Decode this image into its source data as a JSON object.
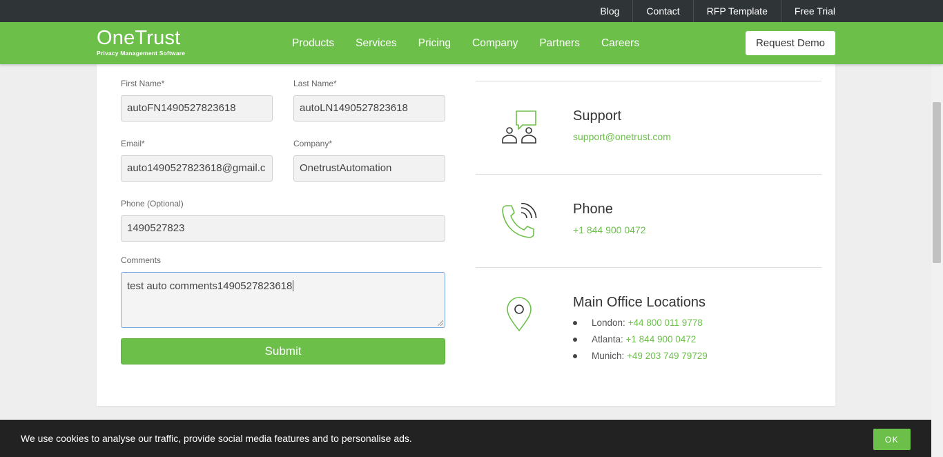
{
  "topbar": {
    "links": [
      "Blog",
      "Contact",
      "RFP Template",
      "Free Trial"
    ]
  },
  "brand": {
    "name": "OneTrust",
    "tagline": "Privacy Management Software",
    "accent": "#6cc04a"
  },
  "nav": {
    "items": [
      "Products",
      "Services",
      "Pricing",
      "Company",
      "Partners",
      "Careers"
    ],
    "cta": "Request Demo"
  },
  "form": {
    "first_name": {
      "label": "First Name*",
      "value": "autoFN1490527823618"
    },
    "last_name": {
      "label": "Last Name*",
      "value": "autoLN1490527823618"
    },
    "email": {
      "label": "Email*",
      "value": "auto1490527823618@gmail.c"
    },
    "company": {
      "label": "Company*",
      "value": "OnetrustAutomation"
    },
    "phone": {
      "label": "Phone (Optional)",
      "value": "1490527823"
    },
    "comments": {
      "label": "Comments",
      "value": "test auto comments1490527823618"
    },
    "submit": "Submit"
  },
  "contact": {
    "support": {
      "title": "Support",
      "email": "support@onetrust.com"
    },
    "phone": {
      "title": "Phone",
      "number": "+1 844 900 0472"
    },
    "offices": {
      "title": "Main Office Locations",
      "items": [
        {
          "city": "London: ",
          "number": "+44 800 011 9778"
        },
        {
          "city": "Atlanta: ",
          "number": "+1 844 900 0472"
        },
        {
          "city": "Munich: ",
          "number": "+49 203 749 79729"
        }
      ]
    }
  },
  "cookie": {
    "message": "We use cookies to analyse our traffic, provide social media features and to personalise ads.",
    "ok": "OK"
  }
}
